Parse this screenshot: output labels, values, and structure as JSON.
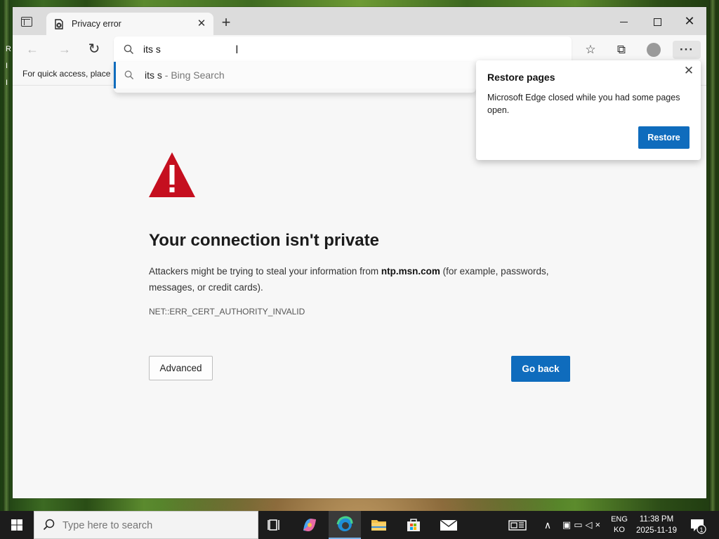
{
  "browser": {
    "tab": {
      "title": "Privacy error"
    },
    "omnibox": {
      "value": "its s"
    },
    "favorites_bar": {
      "text": "For quick access, place your favorites here on the favorites bar."
    },
    "suggestion": {
      "query": "its s",
      "engine_suffix": " - Bing Search"
    }
  },
  "restore_flyout": {
    "title": "Restore pages",
    "message": "Microsoft Edge closed while you had some pages open.",
    "button": "Restore"
  },
  "error_page": {
    "heading": "Your connection isn't private",
    "desc_prefix": "Attackers might be trying to steal your information from ",
    "desc_domain": "ntp.msn.com",
    "desc_suffix": " (for example, passwords, messages, or credit cards).",
    "code": "NET::ERR_CERT_AUTHORITY_INVALID",
    "advanced_button": "Advanced",
    "goback_button": "Go back"
  },
  "desktop": {
    "left_letters": [
      "R",
      "I",
      "I"
    ]
  },
  "taskbar": {
    "search_placeholder": "Type here to search",
    "language_line1": "ENG",
    "language_line2": "KO",
    "time": "11:38 PM",
    "date": "2025-11-19",
    "notification_count": "1"
  },
  "colors": {
    "accent_blue": "#0f6cbd",
    "warning_red": "#c50f1f"
  }
}
